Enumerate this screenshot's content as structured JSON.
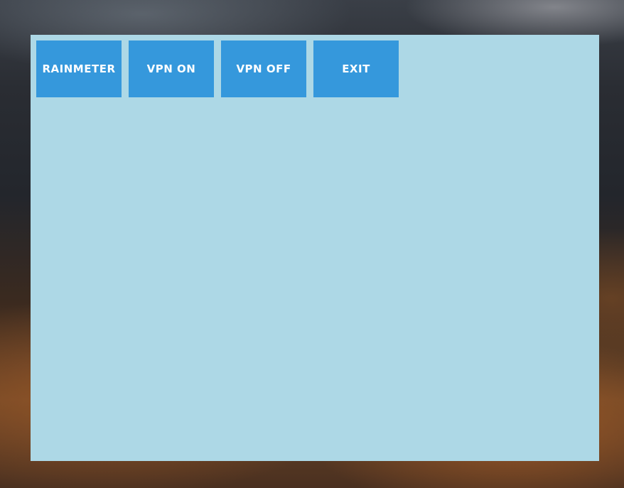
{
  "wallpaper": {
    "description_icon": "mountain-landscape"
  },
  "panel": {
    "background_color": "#add8e6",
    "buttons": [
      {
        "id": "rainmeter",
        "label": "RAINMETER"
      },
      {
        "id": "vpn-on",
        "label": "VPN ON"
      },
      {
        "id": "vpn-off",
        "label": "VPN OFF"
      },
      {
        "id": "exit",
        "label": "EXIT"
      }
    ],
    "button_color": "#3598dc",
    "button_text_color": "#ffffff"
  }
}
